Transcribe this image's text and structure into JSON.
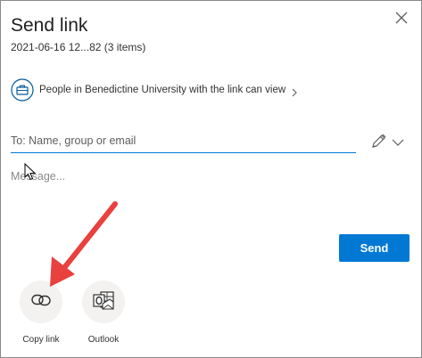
{
  "dialog": {
    "title": "Send link",
    "subtitle": "2021-06-16 12...82 (3 items)",
    "close_icon": "close-icon"
  },
  "permission": {
    "text": "People in Benedictine University with the link can view",
    "icon": "briefcase-icon",
    "chevron_icon": "chevron-right-icon"
  },
  "recipients": {
    "placeholder": "To: Name, group or email",
    "value": "",
    "pencil_icon": "pencil-icon",
    "dropdown_icon": "chevron-down-icon"
  },
  "message": {
    "placeholder": "Message...",
    "value": ""
  },
  "actions": {
    "send_label": "Send"
  },
  "share_options": [
    {
      "label": "Copy link",
      "icon": "link-icon"
    },
    {
      "label": "Outlook",
      "icon": "outlook-icon"
    }
  ],
  "annotation": {
    "arrow_color": "#e8413e"
  },
  "colors": {
    "accent": "#0078d4",
    "arrow": "#e8413e"
  }
}
